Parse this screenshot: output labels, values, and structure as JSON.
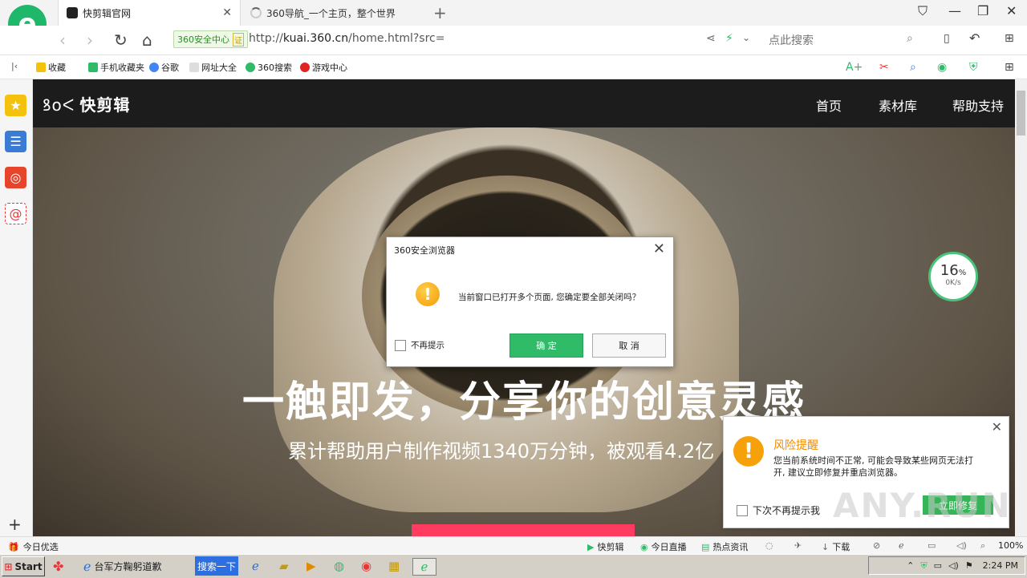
{
  "browser": {
    "tabs": [
      {
        "title": "快剪辑官网",
        "active": true
      },
      {
        "title": "360导航_一个主页，整个世界",
        "active": false
      }
    ],
    "security_badge": "360安全中心",
    "security_badge_mark": "证",
    "url_prefix": "http://",
    "url_domain": "kuai.360.cn",
    "url_path": "/home.html?src=",
    "search_placeholder": "点此搜索"
  },
  "bookmarks": [
    "收藏",
    "手机收藏夹",
    "谷歌",
    "网址大全",
    "360搜索",
    "游戏中心"
  ],
  "site": {
    "logo": "快剪辑",
    "nav": [
      "首页",
      "素材库",
      "帮助支持"
    ],
    "hero_title": "一触即发，分享你的创意灵感",
    "hero_subtitle": "累计帮助用户制作视频1340万分钟，被观看4.2亿"
  },
  "speed_widget": {
    "percent": "16",
    "percent_sign": "%",
    "rate": "0K/s"
  },
  "dialog": {
    "title": "360安全浏览器",
    "message": "当前窗口已打开多个页面, 您确定要全部关闭吗？",
    "checkbox_label": "不再提示",
    "ok_label": "确 定",
    "cancel_label": "取 消"
  },
  "risk_popup": {
    "title": "风险提醒",
    "text": "您当前系统时间不正常, 可能会导致某些网页无法打开, 建议立即修复并重启浏览器。",
    "checkbox_label": "下次不再提示我",
    "button_label": "立即修复"
  },
  "watermark": "ANY.RUN",
  "statusbar": {
    "left": "今日优选",
    "items": [
      "快剪辑",
      "今日直播",
      "热点资讯",
      "下载"
    ],
    "zoom": "100%"
  },
  "taskbar": {
    "start": "Start",
    "ie_label": "台军方鞠躬道歉",
    "search_btn": "搜索一下",
    "time": "2:24 PM"
  },
  "colors": {
    "accent_green": "#2fbb68",
    "warning_orange": "#f6a10a",
    "hero_button": "#ff3c5f"
  }
}
